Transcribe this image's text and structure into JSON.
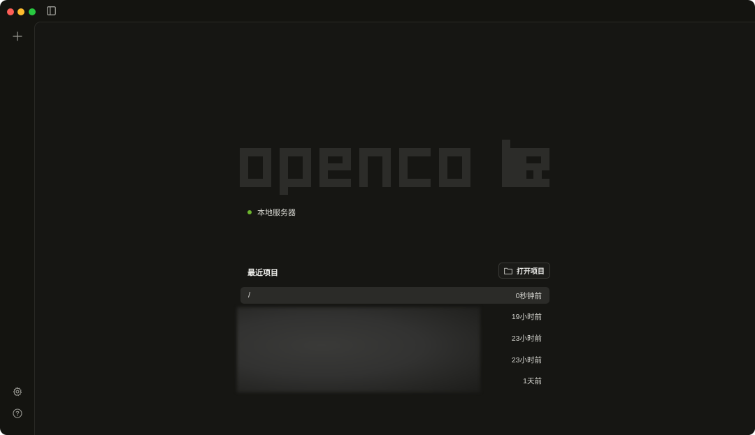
{
  "window": {
    "controls": [
      "close",
      "minimize",
      "maximize"
    ]
  },
  "sidebar": {
    "new_icon": "plus-icon",
    "settings_icon": "gear-icon",
    "help_icon": "help-circle-icon"
  },
  "logo": {
    "text": "opencode"
  },
  "server": {
    "label": "本地服务器",
    "status_color": "#6cb52e"
  },
  "recent": {
    "title": "最近项目",
    "open_button": "打开项目",
    "open_icon": "folder-icon",
    "projects": [
      {
        "path": "/",
        "time": "0秒钟前"
      },
      {
        "path": "",
        "time": "19小时前"
      },
      {
        "path": "",
        "time": "23小时前"
      },
      {
        "path": "",
        "time": "23小时前"
      },
      {
        "path": "",
        "time": "1天前"
      }
    ]
  }
}
